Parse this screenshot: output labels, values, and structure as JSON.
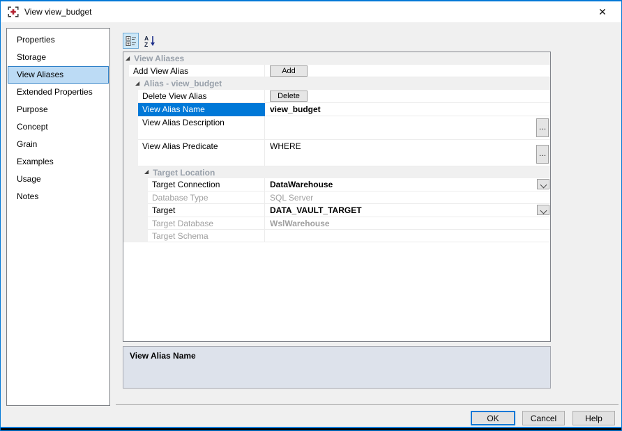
{
  "window": {
    "title": "View view_budget",
    "close_glyph": "✕"
  },
  "sidebar": {
    "items": [
      {
        "label": "Properties",
        "selected": false
      },
      {
        "label": "Storage",
        "selected": false
      },
      {
        "label": "View Aliases",
        "selected": true
      },
      {
        "label": "Extended Properties",
        "selected": false
      },
      {
        "label": "Purpose",
        "selected": false
      },
      {
        "label": "Concept",
        "selected": false
      },
      {
        "label": "Grain",
        "selected": false
      },
      {
        "label": "Examples",
        "selected": false
      },
      {
        "label": "Usage",
        "selected": false
      },
      {
        "label": "Notes",
        "selected": false
      }
    ]
  },
  "toolbar": {
    "az_top": "A",
    "az_bottom": "Z"
  },
  "grid": {
    "expander_glyph": "◢",
    "ellipsis_label": "…",
    "rows": [
      {
        "type": "category",
        "level": 0,
        "label": "View Aliases"
      },
      {
        "type": "button",
        "level": 0,
        "label": "Add View Alias",
        "button": "Add"
      },
      {
        "type": "category",
        "level": 1,
        "label": "Alias - view_budget"
      },
      {
        "type": "button",
        "level": 1,
        "label": "Delete View Alias",
        "button": "Delete"
      },
      {
        "type": "text",
        "level": 1,
        "label": "View Alias Name",
        "value": "view_budget",
        "selected": true,
        "bold": true
      },
      {
        "type": "multiline",
        "level": 1,
        "label": "View Alias Description",
        "value": "",
        "ellipsis": true
      },
      {
        "type": "multiline",
        "level": 1,
        "label": "View Alias Predicate",
        "value": "WHERE",
        "ellipsis": true
      },
      {
        "type": "category",
        "level": 2,
        "label": "Target Location"
      },
      {
        "type": "dropdown",
        "level": 2,
        "label": "Target Connection",
        "value": "DataWarehouse",
        "bold": true
      },
      {
        "type": "text",
        "level": 2,
        "label": "Database Type",
        "value": "SQL Server",
        "disabled": true
      },
      {
        "type": "dropdown",
        "level": 2,
        "label": "Target",
        "value": "DATA_VAULT_TARGET",
        "bold": true
      },
      {
        "type": "text",
        "level": 2,
        "label": "Target Database",
        "value": "WslWarehouse",
        "disabled": true,
        "bold": true
      },
      {
        "type": "text",
        "level": 2,
        "label": "Target Schema",
        "value": "",
        "disabled": true
      }
    ]
  },
  "description_panel": {
    "title": "View Alias Name"
  },
  "footer": {
    "ok": "OK",
    "cancel": "Cancel",
    "help": "Help"
  },
  "colors": {
    "accent": "#0078d7",
    "selection_bg": "#0078d7",
    "category_text": "#98a0aa",
    "window_border": "#0078d7",
    "sidebar_selection_bg": "#bcdbf5",
    "desc_panel_bg": "#dde2eb"
  }
}
